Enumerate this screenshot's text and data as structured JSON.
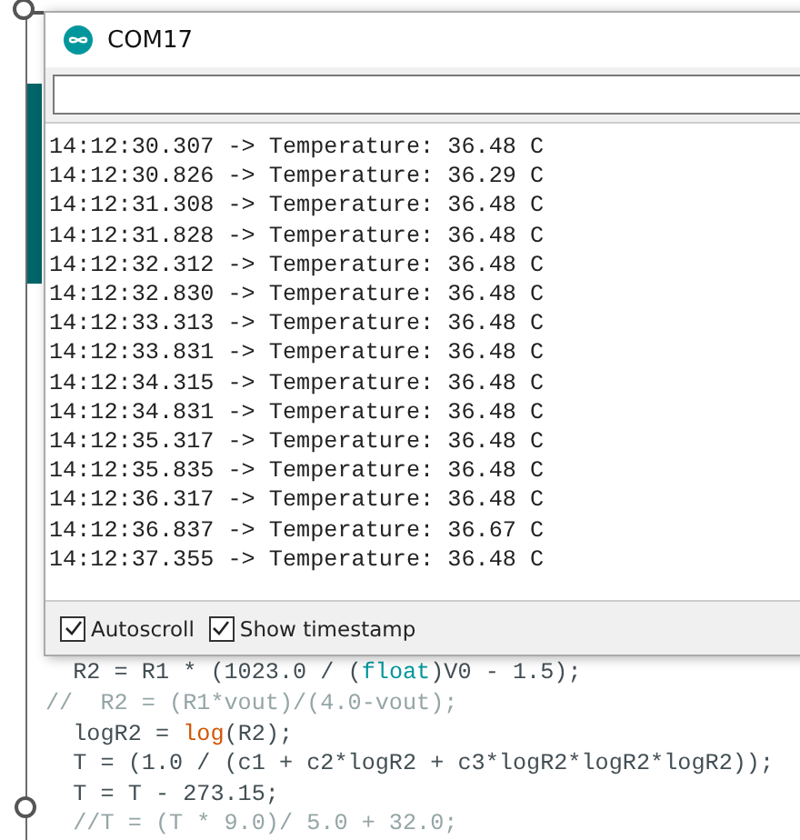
{
  "serial_monitor": {
    "title": "COM17",
    "output_lines": [
      "14:12:30.307 -> Temperature: 36.48 C",
      "14:12:30.826 -> Temperature: 36.29 C",
      "14:12:31.308 -> Temperature: 36.48 C",
      "14:12:31.828 -> Temperature: 36.48 C",
      "14:12:32.312 -> Temperature: 36.48 C",
      "14:12:32.830 -> Temperature: 36.48 C",
      "14:12:33.313 -> Temperature: 36.48 C",
      "14:12:33.831 -> Temperature: 36.48 C",
      "14:12:34.315 -> Temperature: 36.48 C",
      "14:12:34.831 -> Temperature: 36.48 C",
      "14:12:35.317 -> Temperature: 36.48 C",
      "14:12:35.835 -> Temperature: 36.48 C",
      "14:12:36.317 -> Temperature: 36.48 C",
      "14:12:36.837 -> Temperature: 36.67 C",
      "14:12:37.355 -> Temperature: 36.48 C"
    ],
    "options": [
      {
        "label": "Autoscroll",
        "checked": true
      },
      {
        "label": "Show timestamp",
        "checked": true
      }
    ]
  },
  "editor": {
    "lines": [
      {
        "segments": [
          {
            "kind": "plain",
            "text": "  R2 = R1 * (1023.0 / ("
          },
          {
            "kind": "type",
            "text": "float"
          },
          {
            "kind": "plain",
            "text": ")V0 - 1.5);"
          }
        ]
      },
      {
        "segments": [
          {
            "kind": "comment",
            "text": "//  R2 = (R1*vout)/(4.0-vout);"
          }
        ]
      },
      {
        "segments": [
          {
            "kind": "plain",
            "text": "  logR2 = "
          },
          {
            "kind": "function",
            "text": "log"
          },
          {
            "kind": "plain",
            "text": "(R2);"
          }
        ]
      },
      {
        "segments": [
          {
            "kind": "plain",
            "text": "  T = (1.0 / (c1 + c2*logR2 + c3*logR2*logR2*logR2));"
          }
        ]
      },
      {
        "segments": [
          {
            "kind": "plain",
            "text": "  T = T - 273.15;"
          }
        ]
      },
      {
        "segments": [
          {
            "kind": "comment",
            "text": "  //T = (T * 9.0)/ 5.0 + 32.0;"
          }
        ]
      }
    ]
  }
}
